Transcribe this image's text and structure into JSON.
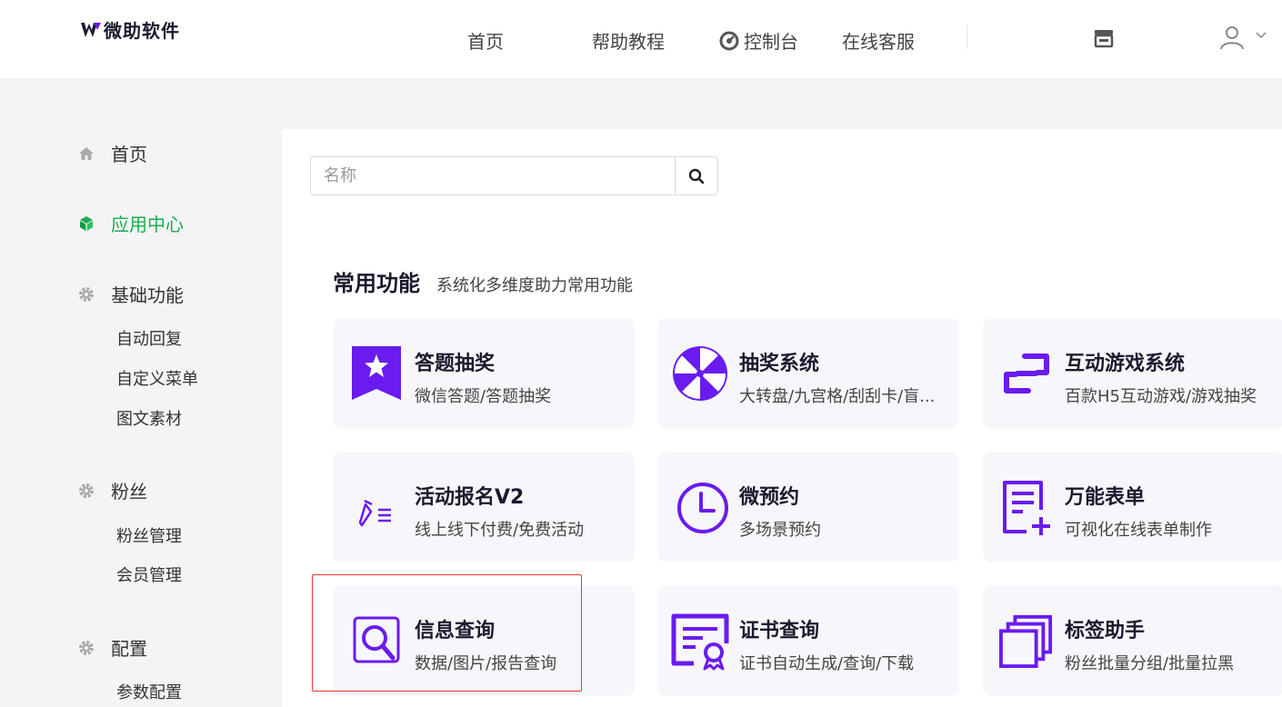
{
  "brand": {
    "name": "微助软件"
  },
  "nav": {
    "items": [
      {
        "label": "首页"
      },
      {
        "label": "帮助教程"
      },
      {
        "label": "控制台"
      },
      {
        "label": "在线客服"
      }
    ]
  },
  "sidebar": {
    "groups": [
      {
        "label": "首页",
        "icon": "home-icon",
        "subs": []
      },
      {
        "label": "应用中心",
        "icon": "cube-icon",
        "active": true,
        "subs": []
      },
      {
        "label": "基础功能",
        "icon": "gear-icon",
        "subs": [
          "自动回复",
          "自定义菜单",
          "图文素材"
        ]
      },
      {
        "label": "粉丝",
        "icon": "gear-icon",
        "subs": [
          "粉丝管理",
          "会员管理"
        ]
      },
      {
        "label": "配置",
        "icon": "gear-icon",
        "subs": [
          "参数配置"
        ]
      }
    ]
  },
  "search": {
    "placeholder": "名称"
  },
  "section": {
    "title": "常用功能",
    "subtitle": "系统化多维度助力常用功能"
  },
  "cards": [
    {
      "title": "答题抽奖",
      "desc": "微信答题/答题抽奖",
      "icon": "quiz-star-icon"
    },
    {
      "title": "抽奖系统",
      "desc": "大转盘/九宫格/刮刮卡/盲...",
      "icon": "lottery-wheel-icon"
    },
    {
      "title": "互动游戏系统",
      "desc": "百款H5互动游戏/游戏抽奖",
      "icon": "game-link-icon"
    },
    {
      "title": "活动报名V2",
      "desc": "线上线下付费/免费活动",
      "icon": "pen-list-icon"
    },
    {
      "title": "微预约",
      "desc": "多场景预约",
      "icon": "clock-icon"
    },
    {
      "title": "万能表单",
      "desc": "可视化在线表单制作",
      "icon": "form-add-icon"
    },
    {
      "title": "信息查询",
      "desc": "数据/图片/报告查询",
      "icon": "search-doc-icon"
    },
    {
      "title": "证书查询",
      "desc": "证书自动生成/查询/下载",
      "icon": "certificate-icon"
    },
    {
      "title": "标签助手",
      "desc": "粉丝批量分组/批量拉黑",
      "icon": "stack-icon"
    }
  ],
  "colors": {
    "accent": "#6a1bf0",
    "active": "#1aae4e",
    "highlight": "#e53935"
  }
}
